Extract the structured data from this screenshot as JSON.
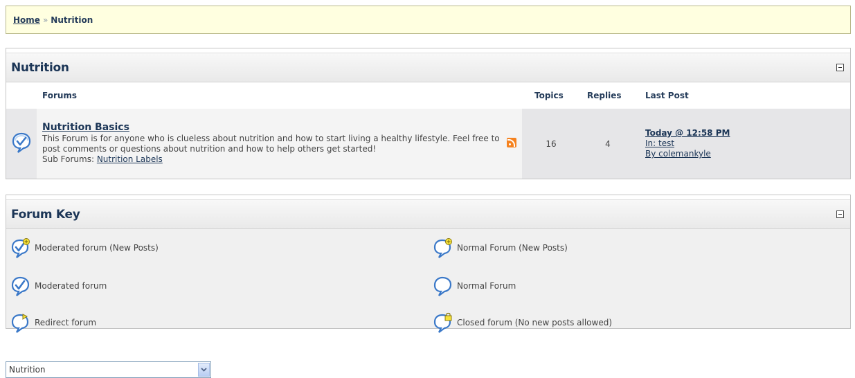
{
  "breadcrumb": {
    "home_label": "Home",
    "separator": "»",
    "current_label": "Nutrition"
  },
  "forum_panel": {
    "title": "Nutrition",
    "collapse_icon": "collapse-icon",
    "columns": {
      "forums": "Forums",
      "topics": "Topics",
      "replies": "Replies",
      "last_post": "Last Post"
    },
    "rows": [
      {
        "status_icon": "moderated-forum-icon",
        "name": "Nutrition Basics",
        "description": "This Forum is for anyone who is clueless about nutrition and how to start living a healthy lifestyle.  Feel free to post comments or questions about nutrition and how to help others get started!",
        "rss_icon": "rss-feed-icon",
        "subforums_label": "Sub Forums:",
        "subforums": [
          "Nutrition Labels"
        ],
        "topics": "16",
        "replies": "4",
        "last_post": {
          "date": "Today @ 12:58 PM",
          "in": "In: test",
          "by": "By colemankyle"
        }
      }
    ]
  },
  "forum_key": {
    "title": "Forum Key",
    "collapse_icon": "collapse-icon",
    "items": [
      {
        "icon": "moderated-forum-new-posts-icon",
        "label": "Moderated forum (New Posts)"
      },
      {
        "icon": "normal-forum-new-posts-icon",
        "label": "Normal Forum (New Posts)"
      },
      {
        "icon": "moderated-forum-icon",
        "label": "Moderated forum"
      },
      {
        "icon": "normal-forum-icon",
        "label": "Normal Forum"
      },
      {
        "icon": "redirect-forum-icon",
        "label": "Redirect forum"
      },
      {
        "icon": "closed-forum-icon",
        "label": "Closed forum (No new posts allowed)"
      }
    ]
  },
  "jump_menu": {
    "selected": "Nutrition",
    "arrow_icon": "chevron-down-icon"
  },
  "colors": {
    "breadcrumb_bg": "#ffffe0",
    "title_color": "#1b3556",
    "link_color": "#1b3556",
    "icon_blue": "#3a78c8",
    "icon_badge_yellow": "#f7e33a",
    "rss_orange": "#f5821f"
  }
}
